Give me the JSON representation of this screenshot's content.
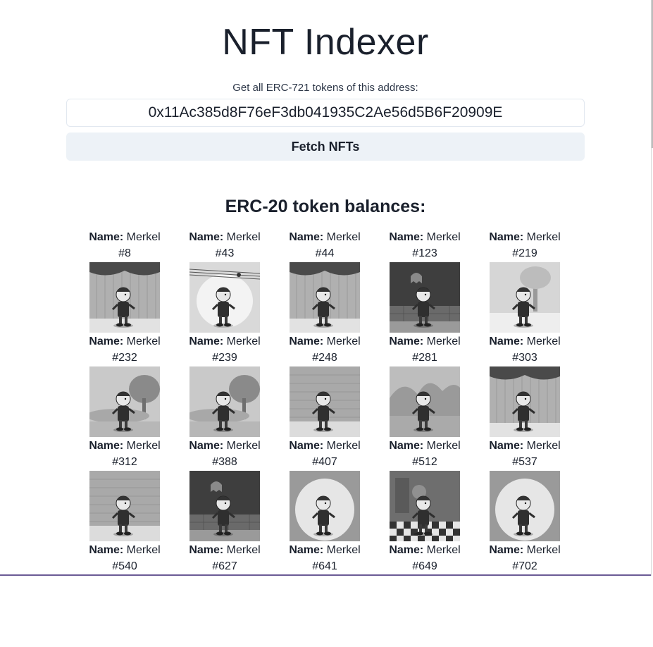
{
  "header": {
    "title": "NFT Indexer",
    "subtitle": "Get all ERC-721 tokens of this address:"
  },
  "search": {
    "address_value": "0x11Ac385d8F76eF3db041935C2Ae56d5B6F20909E",
    "fetch_label": "Fetch NFTs"
  },
  "results": {
    "section_title": "ERC-20 token balances:",
    "name_label": "Name:",
    "items": [
      {
        "name": "Merkel",
        "id": "#8",
        "scene": "curtain"
      },
      {
        "name": "Merkel",
        "id": "#43",
        "scene": "music"
      },
      {
        "name": "Merkel",
        "id": "#44",
        "scene": "curtain"
      },
      {
        "name": "Merkel",
        "id": "#123",
        "scene": "night-ghost"
      },
      {
        "name": "Merkel",
        "id": "#219",
        "scene": "tree"
      },
      {
        "name": "Merkel",
        "id": "#232",
        "scene": "park"
      },
      {
        "name": "Merkel",
        "id": "#239",
        "scene": "park"
      },
      {
        "name": "Merkel",
        "id": "#248",
        "scene": "brick"
      },
      {
        "name": "Merkel",
        "id": "#281",
        "scene": "desert"
      },
      {
        "name": "Merkel",
        "id": "#303",
        "scene": "curtain"
      },
      {
        "name": "Merkel",
        "id": "#312",
        "scene": "brick"
      },
      {
        "name": "Merkel",
        "id": "#388",
        "scene": "night-ghost"
      },
      {
        "name": "Merkel",
        "id": "#407",
        "scene": "spotlight"
      },
      {
        "name": "Merkel",
        "id": "#512",
        "scene": "checker"
      },
      {
        "name": "Merkel",
        "id": "#537",
        "scene": "spotlight"
      },
      {
        "name": "Merkel",
        "id": "#540",
        "scene": "none"
      },
      {
        "name": "Merkel",
        "id": "#627",
        "scene": "none"
      },
      {
        "name": "Merkel",
        "id": "#641",
        "scene": "none"
      },
      {
        "name": "Merkel",
        "id": "#649",
        "scene": "none"
      },
      {
        "name": "Merkel",
        "id": "#702",
        "scene": "none"
      }
    ]
  }
}
